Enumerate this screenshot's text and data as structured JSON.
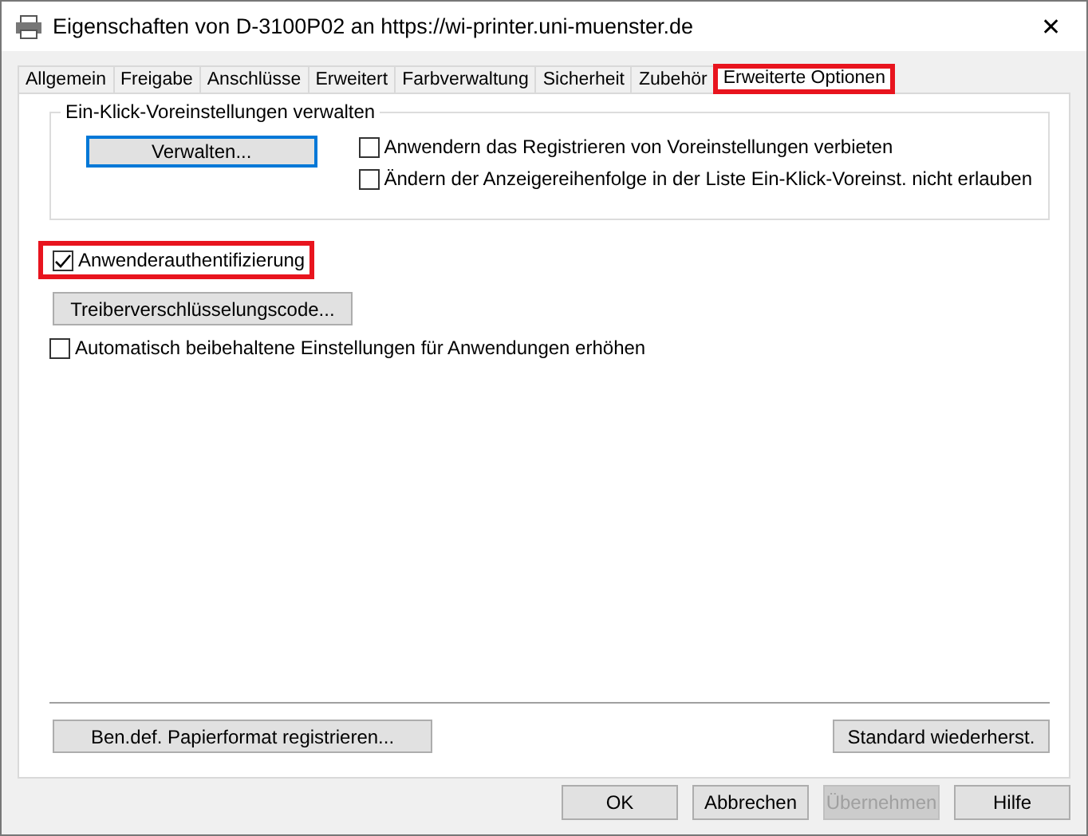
{
  "window": {
    "title": "Eigenschaften von D-3100P02 an https://wi-printer.uni-muenster.de",
    "close": "✕"
  },
  "tabs": [
    {
      "label": "Allgemein",
      "selected": false,
      "highlighted": false
    },
    {
      "label": "Freigabe",
      "selected": false,
      "highlighted": false
    },
    {
      "label": "Anschlüsse",
      "selected": false,
      "highlighted": false
    },
    {
      "label": "Erweitert",
      "selected": false,
      "highlighted": false
    },
    {
      "label": "Farbverwaltung",
      "selected": false,
      "highlighted": false
    },
    {
      "label": "Sicherheit",
      "selected": false,
      "highlighted": false
    },
    {
      "label": "Zubehör",
      "selected": false,
      "highlighted": false
    },
    {
      "label": "Erweiterte Optionen",
      "selected": true,
      "highlighted": true
    }
  ],
  "group": {
    "title": "Ein-Klick-Voreinstellungen verwalten",
    "button": "Verwalten...",
    "options": [
      {
        "label": "Anwendern das Registrieren von Voreinstellungen verbieten",
        "checked": false
      },
      {
        "label": "Ändern der Anzeigereihenfolge in der Liste Ein-Klick-Voreinst. nicht erlauben",
        "checked": false
      }
    ]
  },
  "user_auth": {
    "label": "Anwenderauthentifizierung",
    "checked": true,
    "highlighted": true
  },
  "encryption_button": "Treiberverschlüsselungscode...",
  "auto_option": {
    "label": "Automatisch beibehaltene Einstellungen für Anwendungen erhöhen",
    "checked": false
  },
  "panel_buttons": [
    "Ben.def. Papierformat registrieren...",
    "Standard wiederherst."
  ],
  "dialog_buttons": [
    {
      "label": "OK",
      "disabled": false
    },
    {
      "label": "Abbrechen",
      "disabled": false
    },
    {
      "label": "Übernehmen",
      "disabled": true
    },
    {
      "label": "Hilfe",
      "disabled": false
    }
  ]
}
